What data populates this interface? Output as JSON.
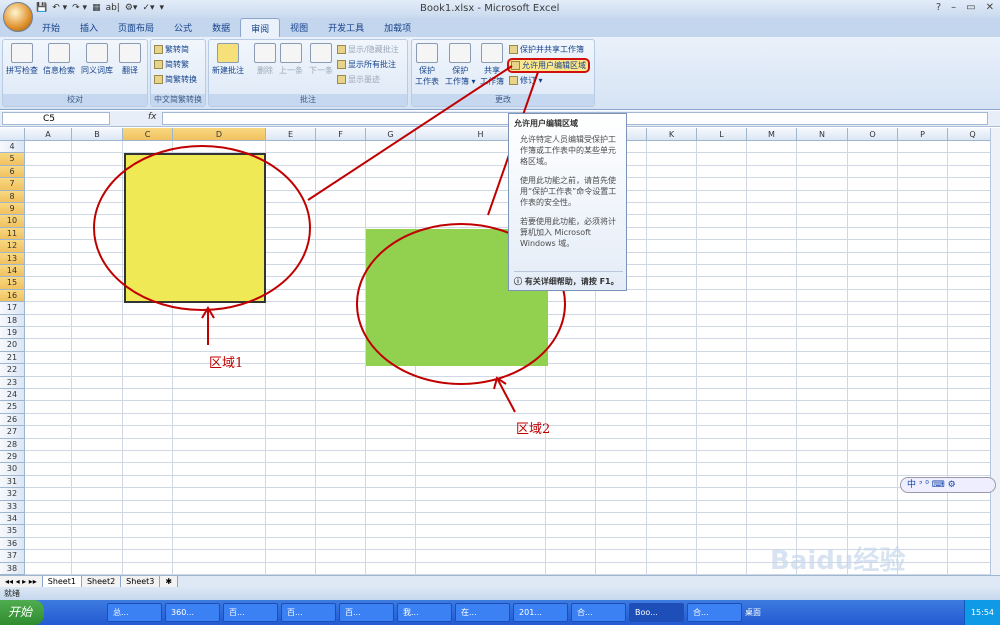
{
  "window": {
    "title": "Book1.xlsx - Microsoft Excel",
    "controls": [
      "?",
      "–",
      "▭",
      "✕"
    ]
  },
  "qat": [
    "💾",
    "↶ ▾",
    "↷ ▾",
    "▦",
    "ab|",
    "⚙▾",
    "✓▾",
    "▾"
  ],
  "tabs": [
    "开始",
    "插入",
    "页面布局",
    "公式",
    "数据",
    "审阅",
    "视图",
    "开发工具",
    "加载项"
  ],
  "active_tab": "审阅",
  "ribbon": {
    "proofing": {
      "label": "校对",
      "buttons": [
        "拼写检查",
        "信息检索",
        "同义词库",
        "翻译"
      ]
    },
    "chinese": {
      "label": "中文简繁转换",
      "buttons": [
        "繁转简",
        "简转繁",
        "简繁转换"
      ]
    },
    "comments": {
      "label": "批注",
      "new": "新建批注",
      "delete": "删除",
      "prev": "上一条",
      "next": "下一条",
      "show_hide": "显示/隐藏批注",
      "show_all": "显示所有批注",
      "show_ink": "显示墨迹"
    },
    "changes": {
      "label": "更改",
      "protect_sheet": [
        "保护",
        "工作表"
      ],
      "protect_book": [
        "保护",
        "工作簿 ▾"
      ],
      "share_book": [
        "共享",
        "工作簿"
      ],
      "protect_share": "保护并共享工作簿",
      "allow_edit": "允许用户编辑区域",
      "track": "修订 ▾"
    }
  },
  "formula_bar": {
    "name_box": "C5",
    "fx": "fx",
    "value": ""
  },
  "columns": [
    "A",
    "B",
    "C",
    "D",
    "E",
    "F",
    "G",
    "H",
    "I",
    "J",
    "K",
    "L",
    "M",
    "N",
    "O",
    "P",
    "Q"
  ],
  "selected_columns": [
    "C",
    "D"
  ],
  "rows": [
    4,
    5,
    6,
    7,
    8,
    9,
    10,
    11,
    12,
    13,
    14,
    15,
    16,
    17,
    18,
    19,
    20,
    21,
    22,
    23,
    24,
    25,
    26,
    27,
    28,
    29,
    30,
    31,
    32,
    33,
    34,
    35,
    36,
    37,
    38
  ],
  "selected_rows": [
    5,
    6,
    7,
    8,
    9,
    10,
    11,
    12,
    13,
    14,
    15,
    16
  ],
  "tooltip": {
    "title": "允许用户编辑区域",
    "p1": "允许特定人员编辑受保护工作簿或工作表中的某些单元格区域。",
    "p2": "使用此功能之前，请首先使用“保护工作表”命令设置工作表的安全性。",
    "p3": "若要使用此功能，必须将计算机加入 Microsoft Windows 域。",
    "footer": "有关详细帮助，请按 F1。"
  },
  "annotations": {
    "region1": "区域1",
    "region2": "区域2"
  },
  "colors": {
    "annotation": "#c00000",
    "region1_fill": "#eee955",
    "region2_fill": "#92d050"
  },
  "sheets": [
    "Sheet1",
    "Sheet2",
    "Sheet3"
  ],
  "active_sheet": "Sheet1",
  "status": "就绪",
  "ime": "中 ᐣ ⁰ ⌨ ⚙",
  "watermark": "Baidu经验 jingyan.baidu.com",
  "taskbar": {
    "start": "开始",
    "tasks": [
      "总...",
      "360...",
      "百...",
      "百...",
      "百...",
      "我...",
      "在...",
      "201...",
      "合...",
      "Boo...",
      "合..."
    ],
    "active_task": "Boo...",
    "desktop": "桌面",
    "clock": "15:54"
  }
}
